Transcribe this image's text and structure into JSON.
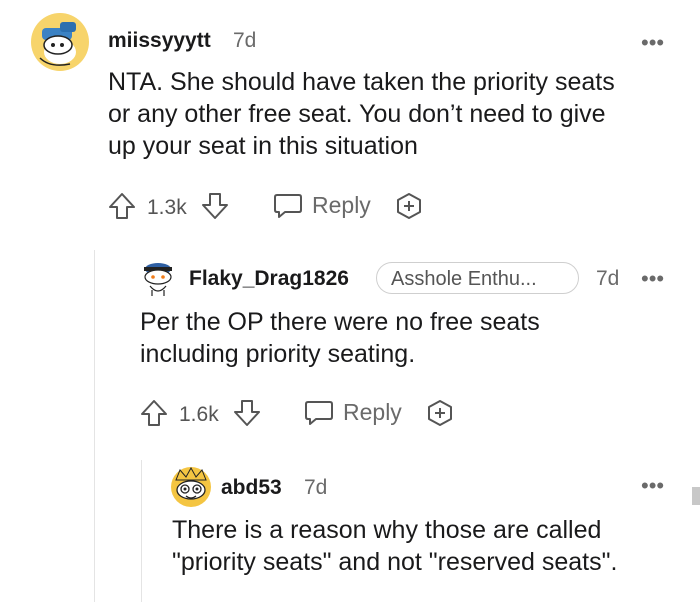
{
  "comments": [
    {
      "username": "miissyyytt",
      "time": "7d",
      "text": [
        "NTA. She should have taken the priority seats",
        "or any other free seat. You don’t need to give",
        "up your seat in this situation"
      ],
      "votes": "1.3k",
      "reply_label": "Reply",
      "more_label": "•••",
      "avatar_icon": "snoo-avatar-icon"
    },
    {
      "username": "Flaky_Drag1826",
      "flair": "Asshole Enthu...",
      "time": "7d",
      "text": [
        "Per the OP there were no free seats",
        "including priority seating."
      ],
      "votes": "1.6k",
      "reply_label": "Reply",
      "more_label": "•••",
      "avatar_icon": "snoo-avatar-icon"
    },
    {
      "username": "abd53",
      "time": "7d",
      "text": [
        "There is a reason why those are called",
        "\"priority seats\" and not \"reserved seats\"."
      ],
      "more_label": "•••",
      "avatar_icon": "snoo-avatar-icon"
    }
  ],
  "colors": {
    "text": "#1a1a1b",
    "muted": "#6a6a6a",
    "thread_line": "#e4e4e4",
    "avatar_yellow": "#f2c94c",
    "avatar_blue": "#3b82c4"
  }
}
